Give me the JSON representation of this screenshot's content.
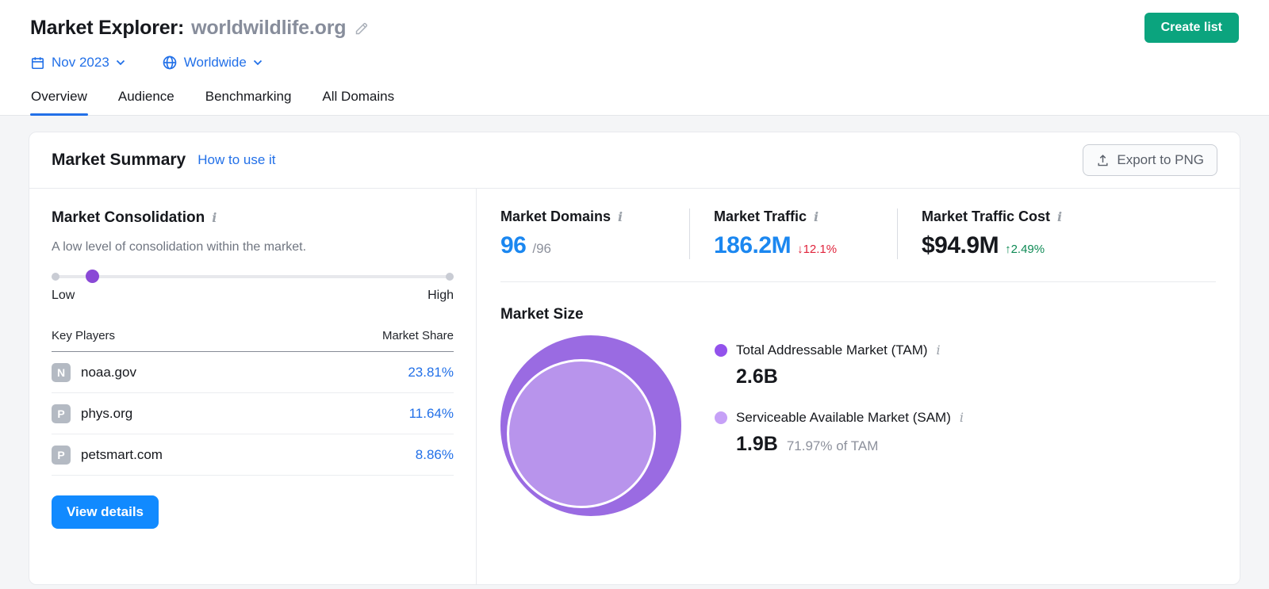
{
  "header": {
    "title_prefix": "Market Explorer:",
    "domain": "worldwildlife.org",
    "create_list_label": "Create list",
    "date_label": "Nov 2023",
    "geo_label": "Worldwide"
  },
  "tabs": [
    {
      "label": "Overview",
      "active": true
    },
    {
      "label": "Audience",
      "active": false
    },
    {
      "label": "Benchmarking",
      "active": false
    },
    {
      "label": "All Domains",
      "active": false
    }
  ],
  "card": {
    "title": "Market Summary",
    "help_link": "How to use it",
    "export_label": "Export to PNG"
  },
  "consolidation": {
    "title": "Market Consolidation",
    "description": "A low level of consolidation within the market.",
    "slider": {
      "low_label": "Low",
      "high_label": "High",
      "thumb_position_pct": 10
    },
    "table": {
      "col_players": "Key Players",
      "col_share": "Market Share",
      "rows": [
        {
          "initial": "N",
          "domain": "noaa.gov",
          "share": "23.81%"
        },
        {
          "initial": "P",
          "domain": "phys.org",
          "share": "11.64%"
        },
        {
          "initial": "P",
          "domain": "petsmart.com",
          "share": "8.86%"
        }
      ]
    },
    "view_details_label": "View details"
  },
  "stats": [
    {
      "label": "Market Domains",
      "value": "96",
      "suffix": "/96"
    },
    {
      "label": "Market Traffic",
      "value": "186.2M",
      "change": "↓12.1%",
      "direction": "down"
    },
    {
      "label": "Market Traffic Cost",
      "value": "$94.9M",
      "change": "↑2.49%",
      "direction": "up"
    }
  ],
  "market_size": {
    "title": "Market Size",
    "tam": {
      "label": "Total Addressable Market (TAM)",
      "value": "2.6B"
    },
    "sam": {
      "label": "Serviceable Available Market (SAM)",
      "value": "1.9B",
      "note": "71.97% of TAM"
    }
  },
  "chart_data": {
    "type": "bubble",
    "title": "Market Size",
    "series": [
      {
        "name": "Total Addressable Market (TAM)",
        "value": 2600000000,
        "value_label": "2.6B",
        "color": "#9a6be2"
      },
      {
        "name": "Serviceable Available Market (SAM)",
        "value": 1900000000,
        "value_label": "1.9B",
        "percent_of_tam": "71.97%",
        "color": "#b894ec"
      }
    ],
    "layout": "nested-circles, SAM inside TAM, legend right"
  },
  "colors": {
    "accent_blue": "#2270e8",
    "value_blue": "#1b87f0",
    "green_button": "#0ba47e",
    "blue_button": "#118aff",
    "negative_red": "#e0243c",
    "positive_green": "#0e8a55",
    "slider_thumb_purple": "#8a49d6",
    "tam_purple": "#9a6be2",
    "sam_purple": "#b894ec"
  }
}
